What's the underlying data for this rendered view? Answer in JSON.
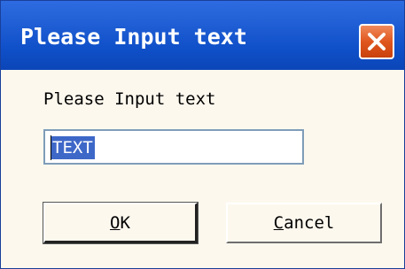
{
  "window": {
    "title": "Please Input text"
  },
  "dialog": {
    "prompt": "Please Input text",
    "input": {
      "value": "TEXT",
      "selected": true
    }
  },
  "buttons": {
    "ok": {
      "mnemonic": "O",
      "rest": "K"
    },
    "cancel": {
      "mnemonic": "C",
      "rest": "ancel"
    }
  },
  "icons": {
    "close": "close-icon"
  },
  "colors": {
    "titlebar": "#1f5ed4",
    "close_button": "#e0561f",
    "dialog_background": "#fdf8ee",
    "selection": "#3e68c8"
  }
}
